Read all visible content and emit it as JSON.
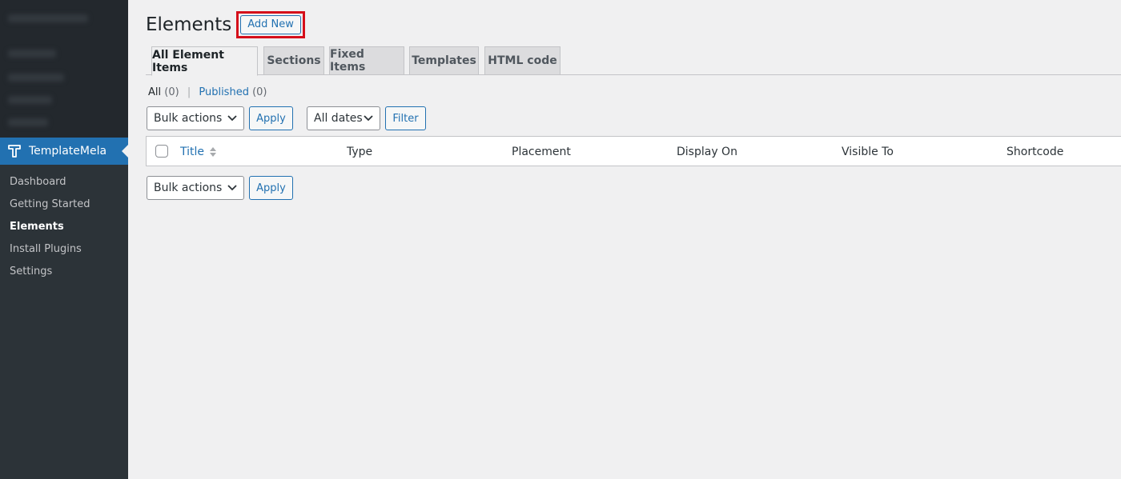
{
  "sidebar": {
    "plugin_name": "TemplateMela",
    "items": [
      {
        "label": "Dashboard"
      },
      {
        "label": "Getting Started"
      },
      {
        "label": "Elements"
      },
      {
        "label": "Install Plugins"
      },
      {
        "label": "Settings"
      }
    ]
  },
  "header": {
    "title": "Elements",
    "add_new_label": "Add New"
  },
  "tabs": [
    {
      "label": "All Element Items"
    },
    {
      "label": "Sections"
    },
    {
      "label": "Fixed Items"
    },
    {
      "label": "Templates"
    },
    {
      "label": "HTML code"
    }
  ],
  "views": {
    "all_label": "All",
    "all_count": "(0)",
    "separator": "|",
    "published_label": "Published",
    "published_count": "(0)"
  },
  "toolbar_top": {
    "bulk_actions": "Bulk actions",
    "apply": "Apply",
    "dates": "All dates",
    "filter": "Filter"
  },
  "table": {
    "columns": [
      "Title",
      "Type",
      "Placement",
      "Display On",
      "Visible To",
      "Shortcode"
    ]
  },
  "toolbar_bottom": {
    "bulk_actions": "Bulk actions",
    "apply": "Apply"
  },
  "colors": {
    "accent": "#2271b1",
    "highlight_box": "#d50e1a",
    "sidebar_bg": "#1d2327"
  }
}
